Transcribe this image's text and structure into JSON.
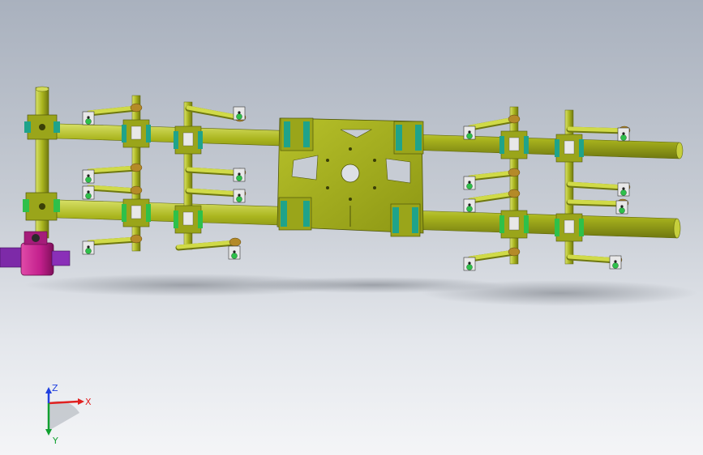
{
  "viewport": {
    "background_top": "#a9b1be",
    "background_bottom": "#f4f5f7"
  },
  "colors": {
    "tube": "#a8b41e",
    "tube_dark": "#6f7810",
    "tube_light": "#d9e26a",
    "arm": "#c8d23a",
    "clamp_teal": "#1fa38a",
    "clamp_green": "#2ec04a",
    "bolt_brass": "#b48a28",
    "bracket_white": "#e8e8e8",
    "fitting_magenta": "#c21f8c",
    "fitting_purple": "#8a2fb8",
    "shadow": "#7c8189"
  },
  "triad": {
    "x_label": "X",
    "y_label": "Y",
    "z_label": "Z",
    "x_color": "#e02020",
    "y_color": "#10a030",
    "z_color": "#2040e0"
  }
}
